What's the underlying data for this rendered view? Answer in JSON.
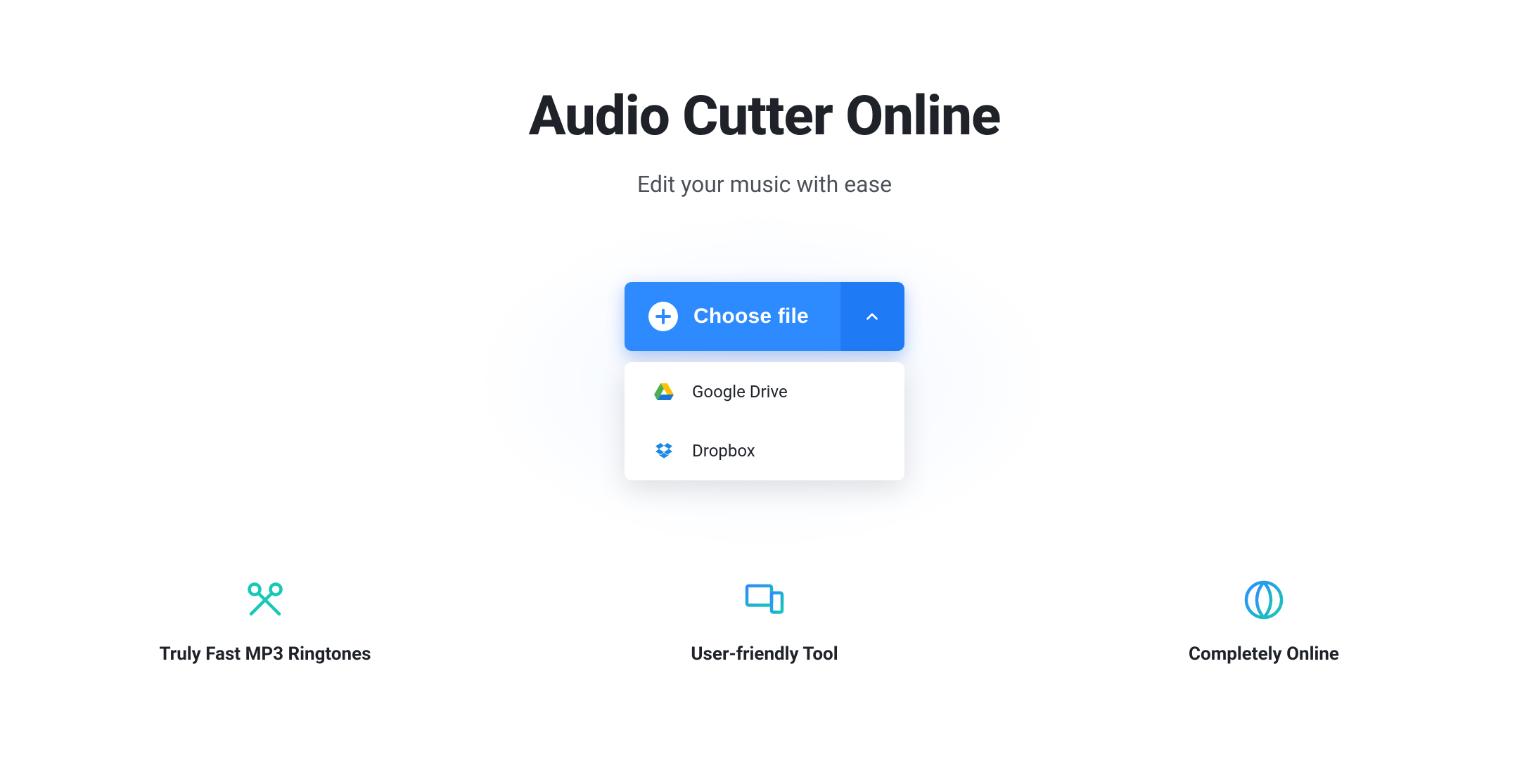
{
  "header": {
    "title": "Audio Cutter Online",
    "subtitle": "Edit your music with ease"
  },
  "upload": {
    "choose_label": "Choose file",
    "sources": [
      {
        "id": "google-drive",
        "label": "Google Drive"
      },
      {
        "id": "dropbox",
        "label": "Dropbox"
      }
    ]
  },
  "features": [
    {
      "id": "fast",
      "title": "Truly Fast MP3 Ringtones"
    },
    {
      "id": "friendly",
      "title": "User-friendly Tool"
    },
    {
      "id": "online",
      "title": "Completely Online"
    }
  ],
  "colors": {
    "primary": "#2e8bff",
    "primary_dark": "#1f7af5",
    "accent_teal": "#15c9b6",
    "text": "#1f2329"
  }
}
